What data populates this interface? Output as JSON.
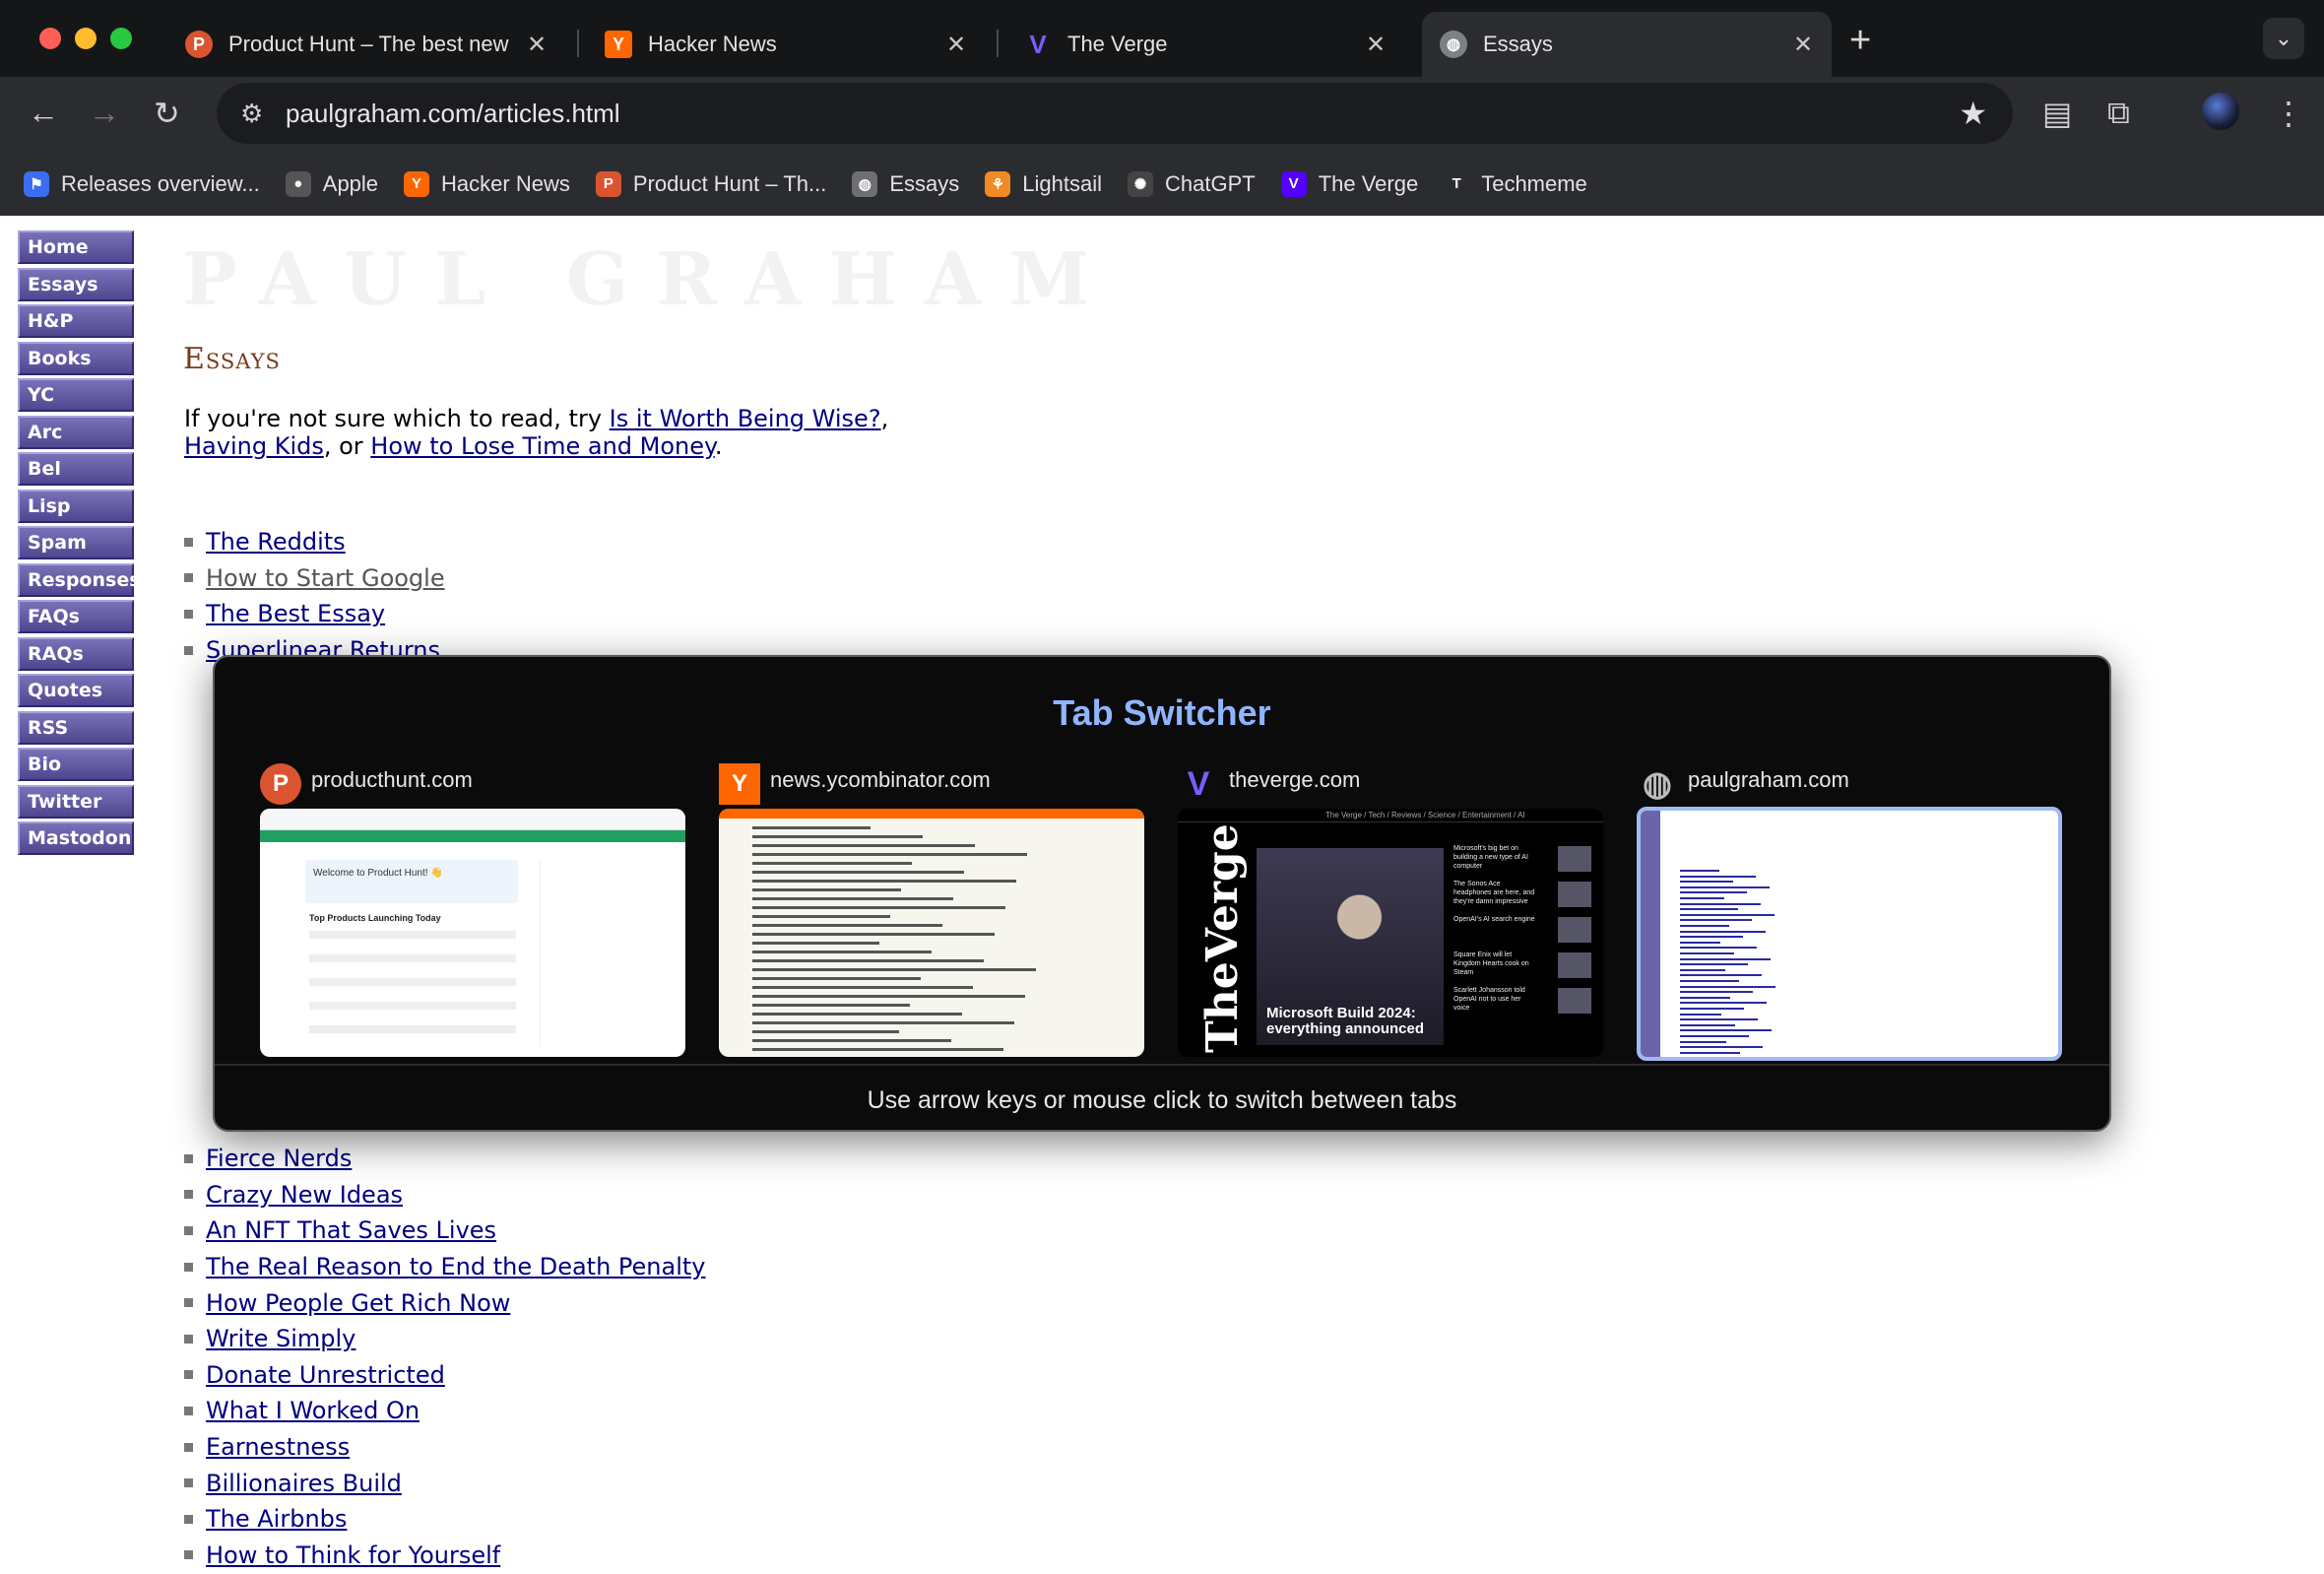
{
  "browser": {
    "tabs": [
      {
        "title": "Product Hunt – The best new",
        "favicon": "P",
        "color": "#da552f"
      },
      {
        "title": "Hacker News",
        "favicon": "Y",
        "color": "#ff6600"
      },
      {
        "title": "The Verge",
        "favicon": "V",
        "color": "#5200ff"
      },
      {
        "title": "Essays",
        "favicon": "globe-icon",
        "color": "#9aa0a6"
      }
    ],
    "url": "paulgraham.com/articles.html",
    "bookmarks": [
      {
        "label": "Releases overview...",
        "icon": "releases-icon",
        "color": "#3b6df0",
        "glyph": "⚑"
      },
      {
        "label": "Apple",
        "icon": "apple-icon",
        "color": "#555555",
        "glyph": "●"
      },
      {
        "label": "Hacker News",
        "icon": "hn-icon",
        "color": "#ff6600",
        "glyph": "Y"
      },
      {
        "label": "Product Hunt – Th...",
        "icon": "producthunt-icon",
        "color": "#da552f",
        "glyph": "P"
      },
      {
        "label": "Essays",
        "icon": "globe-icon",
        "color": "#6d6f73",
        "glyph": "◍"
      },
      {
        "label": "Lightsail",
        "icon": "lightsail-icon",
        "color": "#f08a24",
        "glyph": "⚘"
      },
      {
        "label": "ChatGPT",
        "icon": "chatgpt-icon",
        "color": "#444444",
        "glyph": "✺"
      },
      {
        "label": "The Verge",
        "icon": "verge-icon",
        "color": "#5200ff",
        "glyph": "V"
      },
      {
        "label": "Techmeme",
        "icon": "techmeme-icon",
        "color": "#2b2c30",
        "glyph": "T"
      }
    ]
  },
  "site": {
    "logo": "PAUL GRAHAM",
    "nav": [
      "Home",
      "Essays",
      "H&P",
      "Books",
      "YC",
      "Arc",
      "Bel",
      "Lisp",
      "Spam",
      "Responses",
      "FAQs",
      "RAQs",
      "Quotes",
      "RSS",
      "Bio",
      "Twitter",
      "Mastodon"
    ],
    "heading": "Essays",
    "intro": {
      "prefix": "If you're not sure which to read, try ",
      "link1": "Is it Worth Being Wise?",
      "sep1": ",",
      "link2": "Having Kids",
      "sep2": ", or ",
      "link3": "How to Lose Time and Money",
      "suffix": "."
    },
    "essays_top": [
      "The Reddits",
      "How to Start Google",
      "The Best Essay",
      "Superlinear Returns"
    ],
    "essays_bottom": [
      "Fierce Nerds",
      "Crazy New Ideas",
      "An NFT That Saves Lives",
      "The Real Reason to End the Death Penalty",
      "How People Get Rich Now",
      "Write Simply",
      "Donate Unrestricted",
      "What I Worked On",
      "Earnestness",
      "Billionaires Build",
      "The Airbnbs",
      "How to Think for Yourself"
    ]
  },
  "switcher": {
    "title": "Tab Switcher",
    "hint": "Use arrow keys or mouse click to switch between tabs",
    "cards": [
      {
        "domain": "producthunt.com",
        "glyph": "P",
        "color": "#da552f"
      },
      {
        "domain": "news.ycombinator.com",
        "glyph": "Y",
        "color": "#ff6600"
      },
      {
        "domain": "theverge.com",
        "glyph": "V",
        "color": "#5200ff"
      },
      {
        "domain": "paulgraham.com",
        "glyph": "◍",
        "color": "#333333"
      }
    ],
    "preview": {
      "producthunt": {
        "welcome": "Welcome to Product Hunt! 👋",
        "section": "Top Products Launching Today"
      },
      "verge": {
        "nav": "The Verge  /  Tech  /  Reviews  /  Science  /  Entertainment  /  AI",
        "vertical": "TheVerge",
        "headline": "Microsoft Build 2024: everything announced",
        "stories": [
          "Microsoft's big bet on building a new type of AI computer",
          "The Sonos Ace headphones are here, and they're damn impressive",
          "OpenAI's AI search engine",
          "Square Enix will let Kingdom Hearts cook on Steam",
          "Scarlett Johansson told OpenAI not to use her voice"
        ]
      }
    }
  }
}
